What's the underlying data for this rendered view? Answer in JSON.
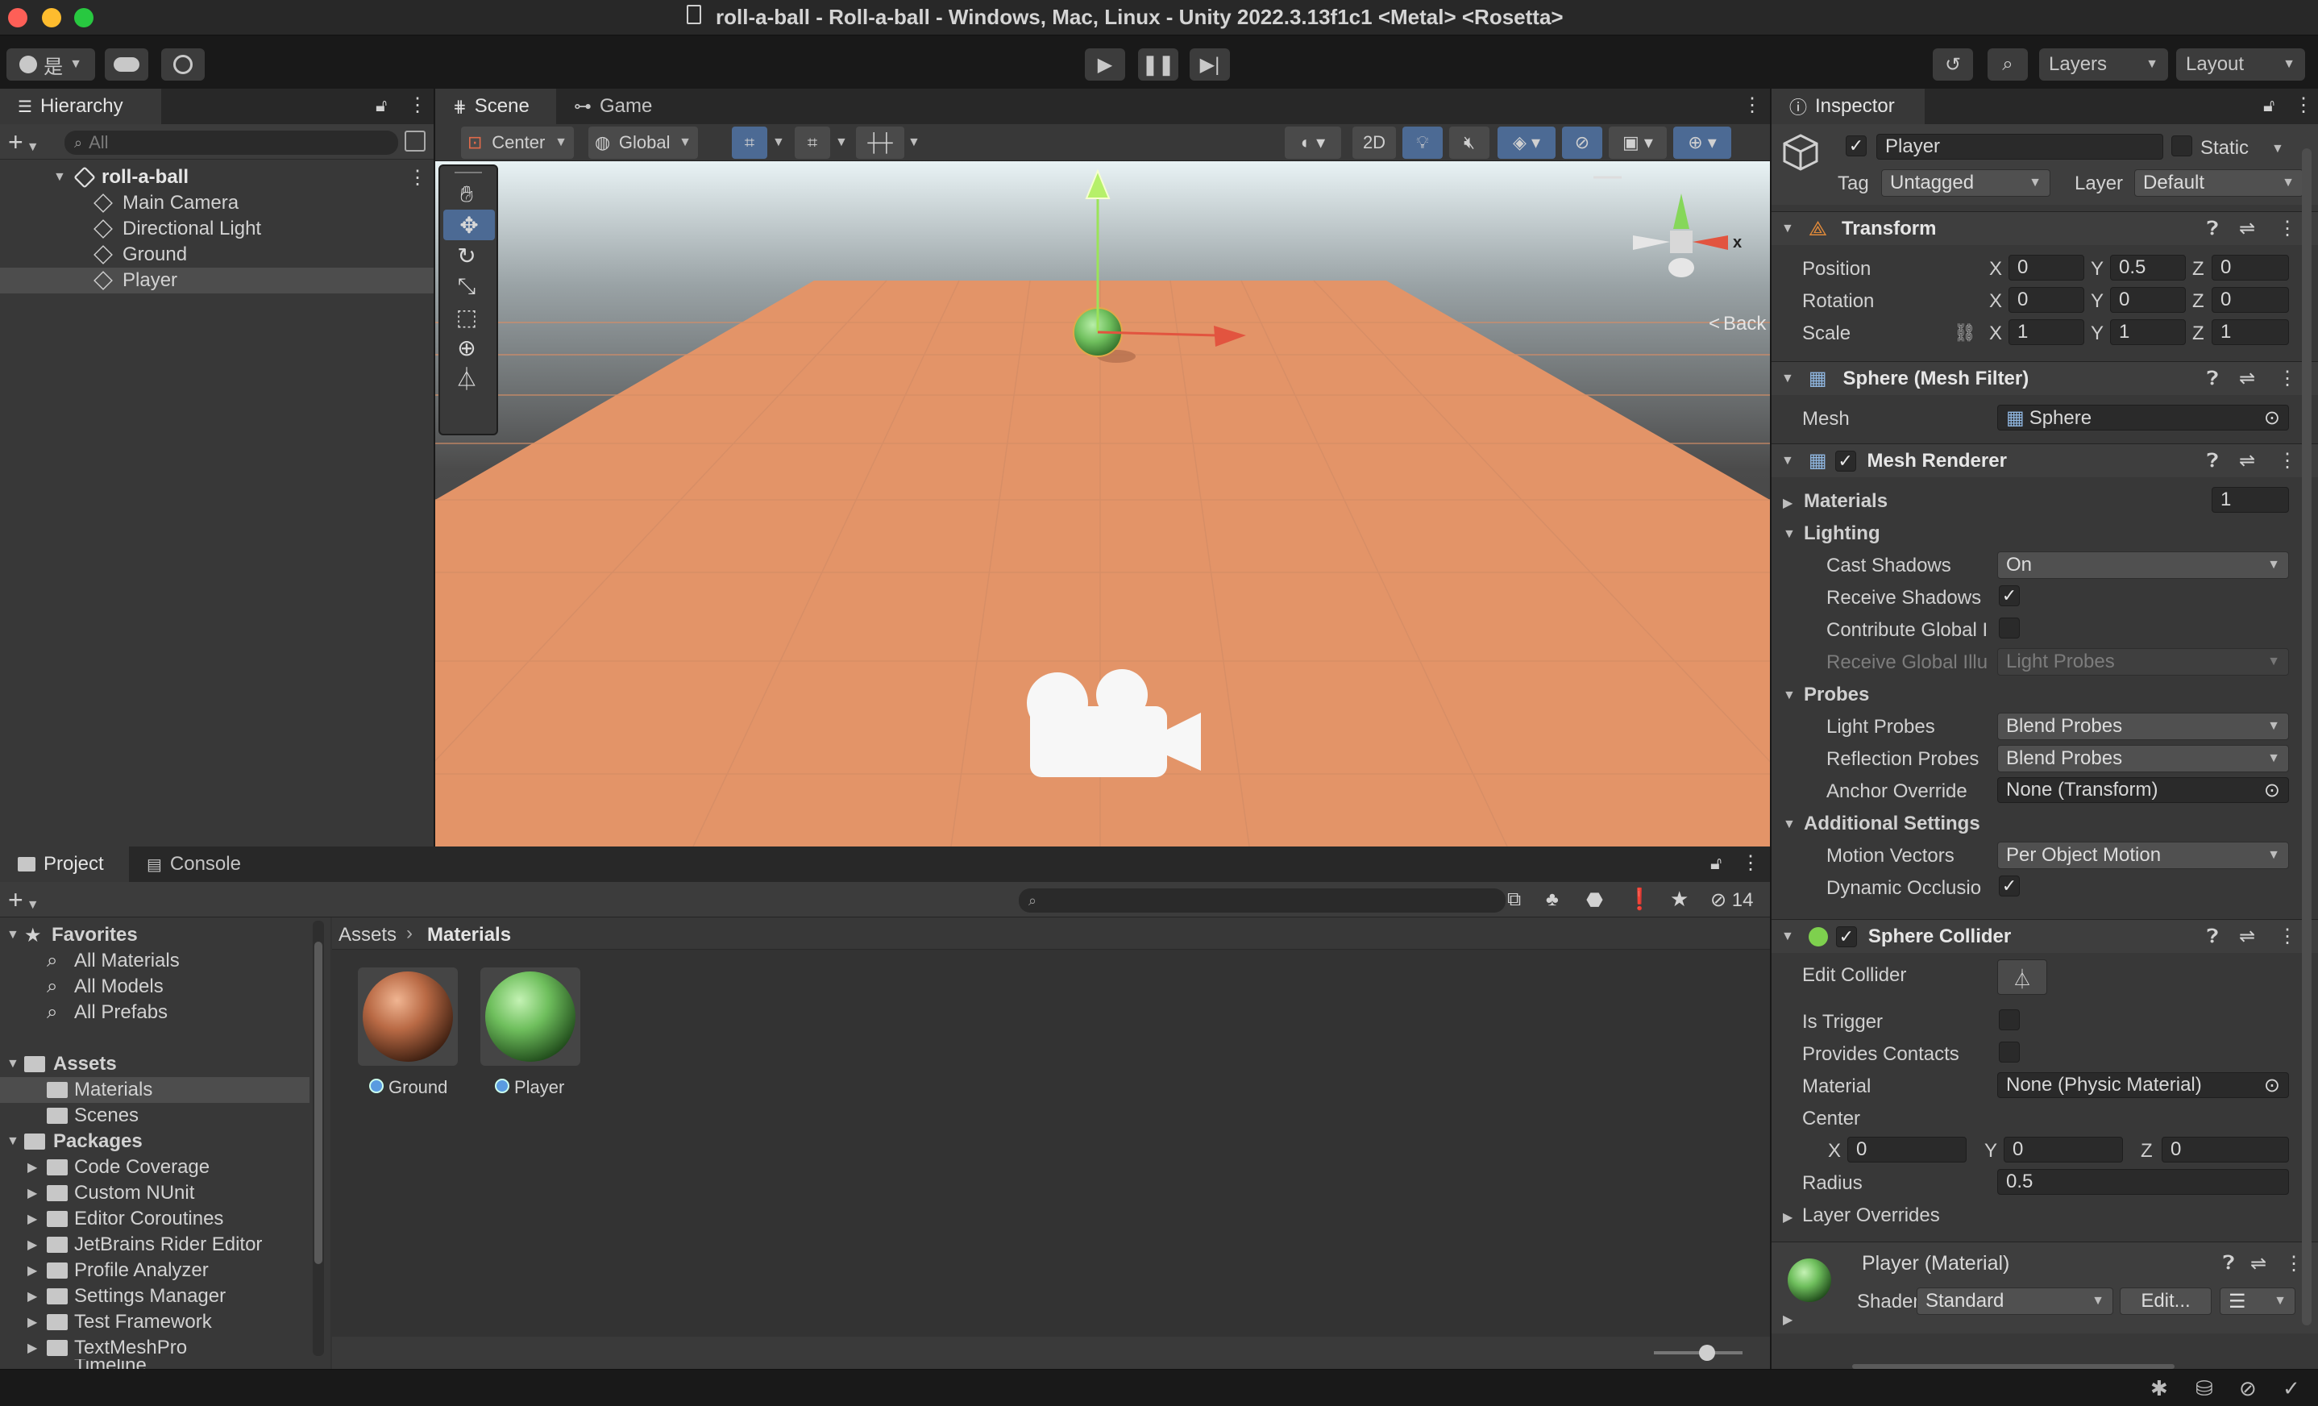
{
  "window": {
    "title": "roll-a-ball - Roll-a-ball - Windows, Mac, Linux - Unity 2022.3.13f1c1 <Metal> <Rosetta>"
  },
  "toolbar": {
    "account_label": "是",
    "layers_label": "Layers",
    "layout_label": "Layout"
  },
  "hierarchy": {
    "tab_label": "Hierarchy",
    "search_placeholder": "All",
    "scene_name": "roll-a-ball",
    "items": [
      {
        "label": "Main Camera"
      },
      {
        "label": "Directional Light"
      },
      {
        "label": "Ground"
      },
      {
        "label": "Player"
      }
    ]
  },
  "scene": {
    "tabs": [
      {
        "label": "Scene"
      },
      {
        "label": "Game"
      }
    ],
    "pivot_label": "Center",
    "space_label": "Global",
    "mode_2d_label": "2D",
    "back_label": "Back",
    "gizmo_axis_label": "x"
  },
  "project": {
    "tabs": [
      {
        "label": "Project"
      },
      {
        "label": "Console"
      }
    ],
    "hidden_count": "14",
    "favorites_label": "Favorites",
    "favorites": [
      {
        "label": "All Materials"
      },
      {
        "label": "All Models"
      },
      {
        "label": "All Prefabs"
      }
    ],
    "assets_label": "Assets",
    "assets_children": [
      {
        "label": "Materials"
      },
      {
        "label": "Scenes"
      }
    ],
    "packages_label": "Packages",
    "packages": [
      {
        "label": "Code Coverage"
      },
      {
        "label": "Custom NUnit"
      },
      {
        "label": "Editor Coroutines"
      },
      {
        "label": "JetBrains Rider Editor"
      },
      {
        "label": "Profile Analyzer"
      },
      {
        "label": "Settings Manager"
      },
      {
        "label": "Test Framework"
      },
      {
        "label": "TextMeshPro"
      },
      {
        "label": "Timeline"
      }
    ],
    "breadcrumb": {
      "root": "Assets",
      "current": "Materials"
    },
    "materials": [
      {
        "label": "Ground",
        "color": "#b96a45"
      },
      {
        "label": "Player",
        "color": "#6fbf5d"
      }
    ]
  },
  "inspector": {
    "tab_label": "Inspector",
    "object_name": "Player",
    "static_label": "Static",
    "tag_label": "Tag",
    "tag_value": "Untagged",
    "layer_label": "Layer",
    "layer_value": "Default",
    "transform": {
      "title": "Transform",
      "position_label": "Position",
      "position": [
        "0",
        "0.5",
        "0"
      ],
      "rotation_label": "Rotation",
      "rotation": [
        "0",
        "0",
        "0"
      ],
      "scale_label": "Scale",
      "scale": [
        "1",
        "1",
        "1"
      ],
      "axes": [
        "X",
        "Y",
        "Z"
      ]
    },
    "mesh_filter": {
      "title": "Sphere (Mesh Filter)",
      "mesh_label": "Mesh",
      "mesh_value": "Sphere"
    },
    "mesh_renderer": {
      "title": "Mesh Renderer",
      "materials_label": "Materials",
      "materials_count": "1",
      "lighting_label": "Lighting",
      "cast_shadows_label": "Cast Shadows",
      "cast_shadows_value": "On",
      "receive_shadows_label": "Receive Shadows",
      "contribute_gi_label": "Contribute Global I",
      "receive_gi_label": "Receive Global Illu",
      "receive_gi_value": "Light Probes",
      "probes_label": "Probes",
      "light_probes_label": "Light Probes",
      "light_probes_value": "Blend Probes",
      "reflection_probes_label": "Reflection Probes",
      "reflection_probes_value": "Blend Probes",
      "anchor_override_label": "Anchor Override",
      "anchor_override_value": "None (Transform)",
      "additional_label": "Additional Settings",
      "motion_vectors_label": "Motion Vectors",
      "motion_vectors_value": "Per Object Motion",
      "dynamic_occlusion_label": "Dynamic Occlusio"
    },
    "sphere_collider": {
      "title": "Sphere Collider",
      "edit_collider_label": "Edit Collider",
      "is_trigger_label": "Is Trigger",
      "provides_contacts_label": "Provides Contacts",
      "material_label": "Material",
      "material_value": "None (Physic Material)",
      "center_label": "Center",
      "center": [
        "0",
        "0",
        "0"
      ],
      "radius_label": "Radius",
      "radius_value": "0.5",
      "layer_overrides_label": "Layer Overrides"
    },
    "material": {
      "title": "Player (Material)",
      "shader_label": "Shader",
      "shader_value": "Standard",
      "edit_label": "Edit..."
    }
  },
  "colors": {
    "accent": "#4c6a94",
    "ground": "#e39468",
    "player": "#6fbf5d"
  }
}
